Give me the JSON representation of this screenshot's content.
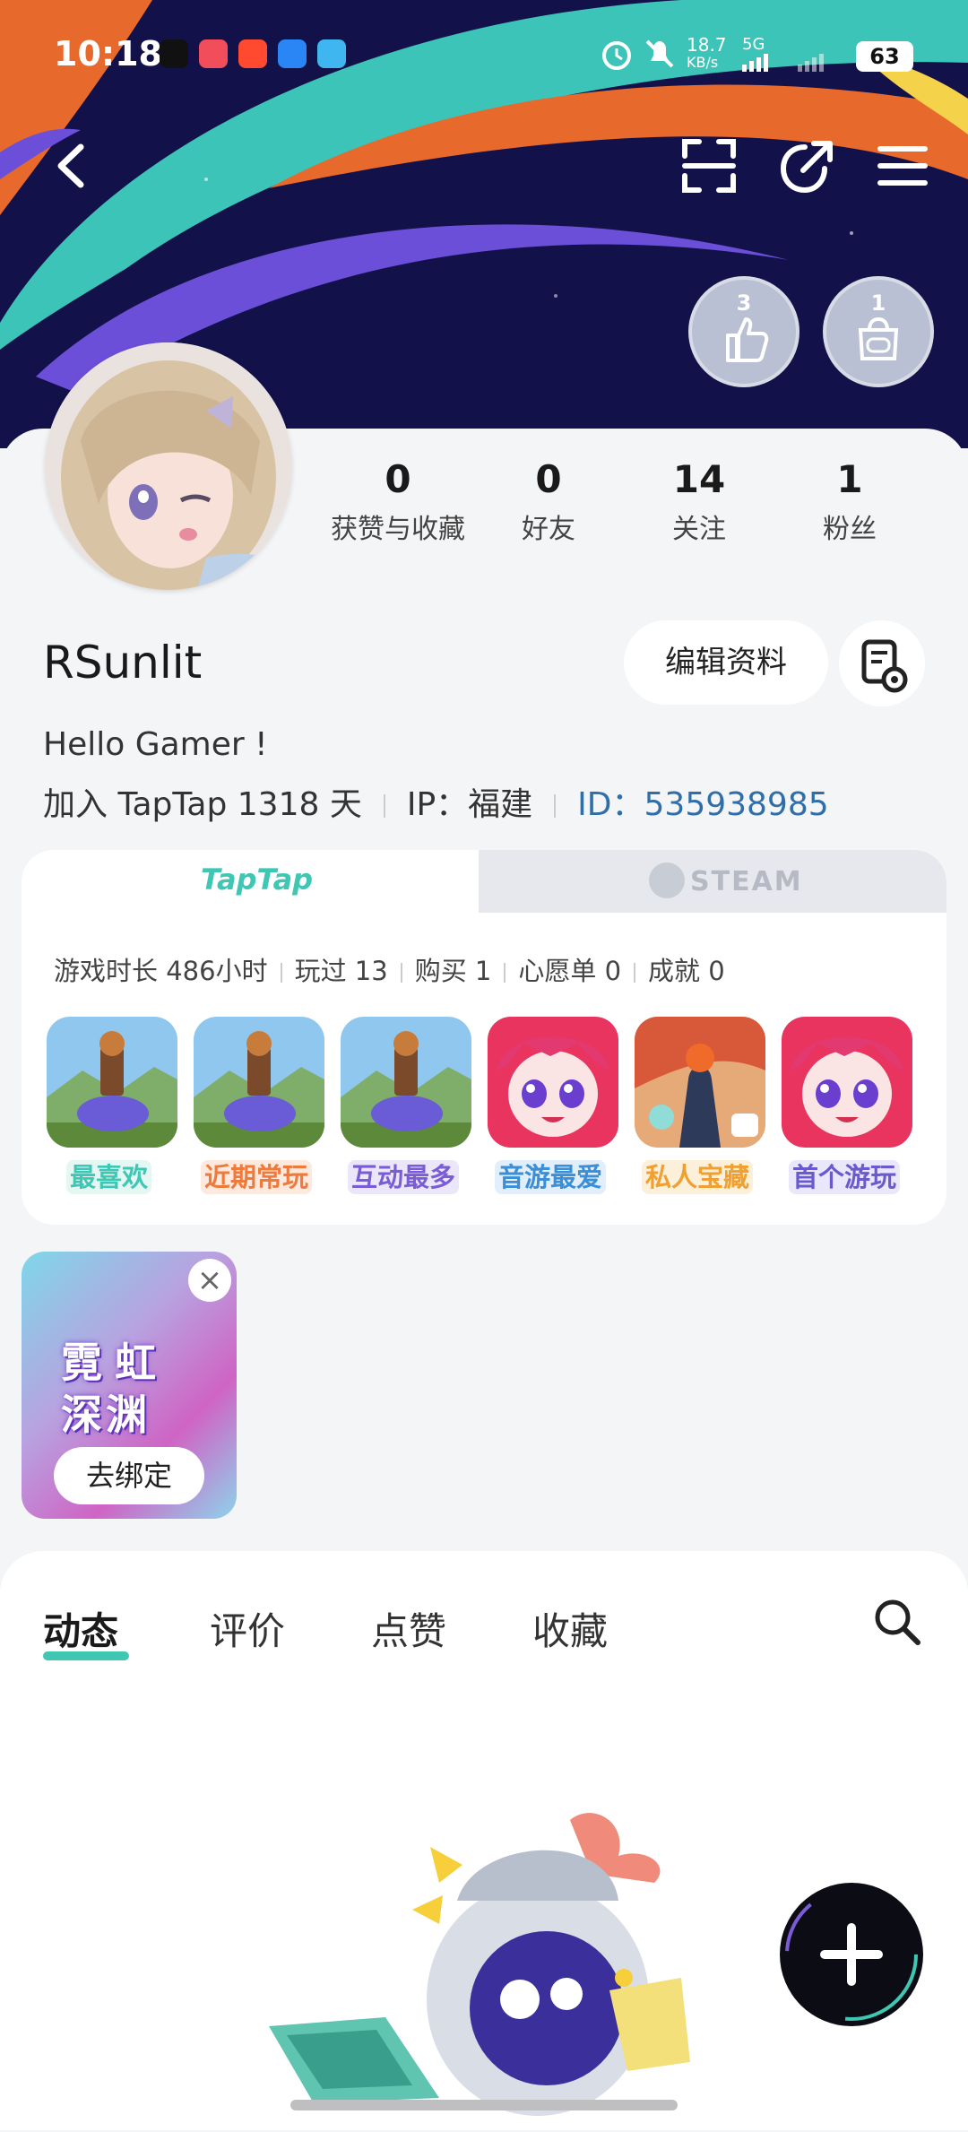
{
  "status_bar": {
    "time": "10:18",
    "net_speed_value": "18.7",
    "net_speed_unit": "KB/s",
    "network": "5G",
    "battery": "63"
  },
  "header": {
    "back_icon": "chevron-left-icon",
    "scan_icon": "scan-icon",
    "share_icon": "share-icon",
    "menu_icon": "hamburger-menu-icon",
    "badges": [
      {
        "count": "3",
        "icon": "thumbs-up-icon"
      },
      {
        "count": "1",
        "icon": "gamepad-bag-icon"
      }
    ]
  },
  "profile": {
    "stats": [
      {
        "value": "0",
        "label": "获赞与收藏"
      },
      {
        "value": "0",
        "label": "好友"
      },
      {
        "value": "14",
        "label": "关注"
      },
      {
        "value": "1",
        "label": "粉丝"
      }
    ],
    "username": "RSunlit",
    "edit_label": "编辑资料",
    "bio": "Hello Gamer !",
    "joined": "加入 TapTap 1318 天",
    "ip": "IP：福建",
    "id": "ID：535938985"
  },
  "games": {
    "tabs": {
      "taptap": "TapTap",
      "steam": "STEAM"
    },
    "stats": [
      "游戏时长 486小时",
      "玩过 13",
      "购买 1",
      "心愿单 0",
      "成就 0"
    ],
    "tiles": [
      {
        "label": "最喜欢",
        "color": "#3fc7b4",
        "bg": "#e4f7f3"
      },
      {
        "label": "近期常玩",
        "color": "#f07a3c",
        "bg": "#fde9dd"
      },
      {
        "label": "互动最多",
        "color": "#7a5cd6",
        "bg": "#ece6fb"
      },
      {
        "label": "音游最爱",
        "color": "#3a8fd6",
        "bg": "#e1eefb"
      },
      {
        "label": "私人宝藏",
        "color": "#f0a030",
        "bg": "#fdf0da"
      },
      {
        "label": "首个游玩",
        "color": "#6a5ad0",
        "bg": "#eae7fb"
      }
    ]
  },
  "promo": {
    "title_line1": "霓虹",
    "title_line2": "深渊",
    "button": "去绑定"
  },
  "content_tabs": [
    "动态",
    "评价",
    "点赞",
    "收藏"
  ],
  "colors": {
    "accent": "#3fc7b4",
    "link": "#2f6ea8"
  }
}
